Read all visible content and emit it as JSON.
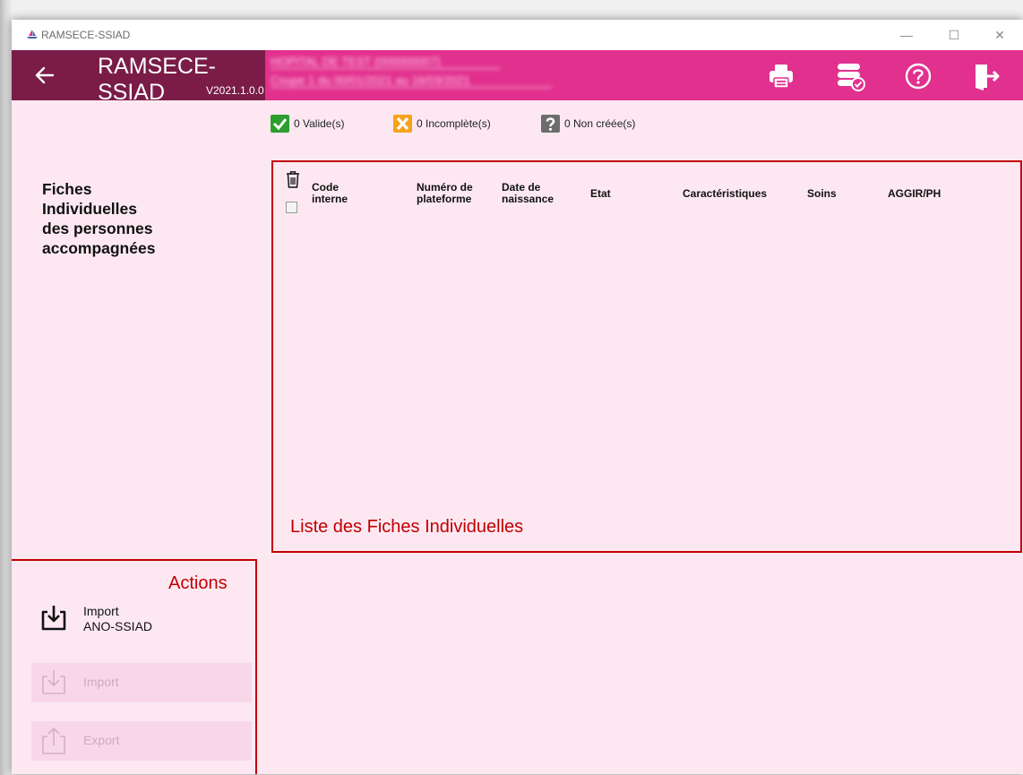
{
  "window": {
    "title": "RAMSECE-SSIAD",
    "controls": {
      "minimize": "—",
      "maximize": "☐",
      "close": "✕"
    }
  },
  "header": {
    "app_name": "RAMSECE-SSIAD",
    "version": "V2021.1.0.0",
    "establishment_line": "HOPITAL DE TEST (000000007)",
    "period_line": "Coupe 1 du 00/01/2021 au 16/03/2021",
    "icons": [
      "back-arrow-icon",
      "printer-icon",
      "database-check-icon",
      "help-icon",
      "exit-icon"
    ]
  },
  "stats": {
    "valid": "0 Valide(s)",
    "incomplete": "0 Incomplète(s)",
    "not_created": "0 Non créée(s)"
  },
  "section": {
    "title_lines": [
      "Fiches",
      "Individuelles",
      "des personnes",
      "accompagnées"
    ]
  },
  "table": {
    "columns": [
      {
        "line1": "Code",
        "line2": "interne"
      },
      {
        "line1": "Numéro de",
        "line2": "plateforme"
      },
      {
        "line1": "Date de",
        "line2": "naissance"
      },
      {
        "line1": "Etat"
      },
      {
        "line1": "Caractéristiques"
      },
      {
        "line1": "Soins"
      },
      {
        "line1": "AGGIR/PH"
      }
    ],
    "rows": [],
    "caption": "Liste des Fiches Individuelles"
  },
  "actions": {
    "title": "Actions",
    "import_ano": {
      "line1": "Import",
      "line2": "ANO-SSIAD"
    },
    "import": "Import",
    "export": "Export"
  },
  "colors": {
    "header_pink": "#e2308e",
    "header_dark": "#7a1c47",
    "content_bg": "#fde8f2",
    "annotation_red": "#c00000",
    "valid_green": "#2e9e2e",
    "incomplete_orange": "#f7a21b",
    "not_created_gray": "#6d6d6d"
  }
}
